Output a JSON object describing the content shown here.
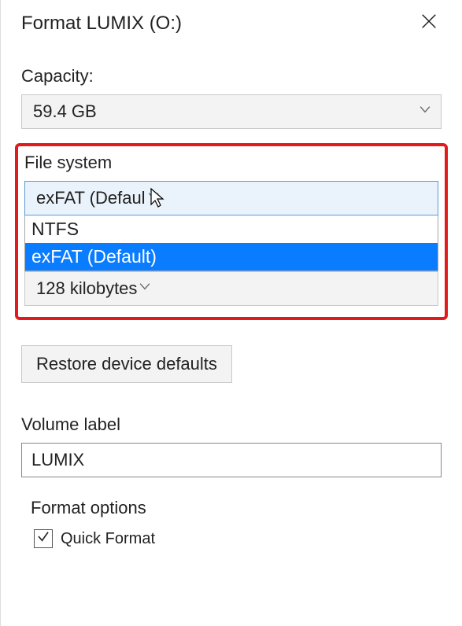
{
  "title": "Format LUMIX (O:)",
  "capacity": {
    "label": "Capacity:",
    "value": "59.4 GB"
  },
  "filesystem": {
    "label": "File system",
    "value": "exFAT (Defaul",
    "options": [
      "NTFS",
      "exFAT (Default)"
    ],
    "selected_index": 1
  },
  "allocation": {
    "value": "128 kilobytes"
  },
  "restore_defaults_label": "Restore device defaults",
  "volume_label": {
    "label": "Volume label",
    "value": "LUMIX"
  },
  "format_options": {
    "label": "Format options",
    "quick_format_label": "Quick Format",
    "quick_format_checked": true
  }
}
